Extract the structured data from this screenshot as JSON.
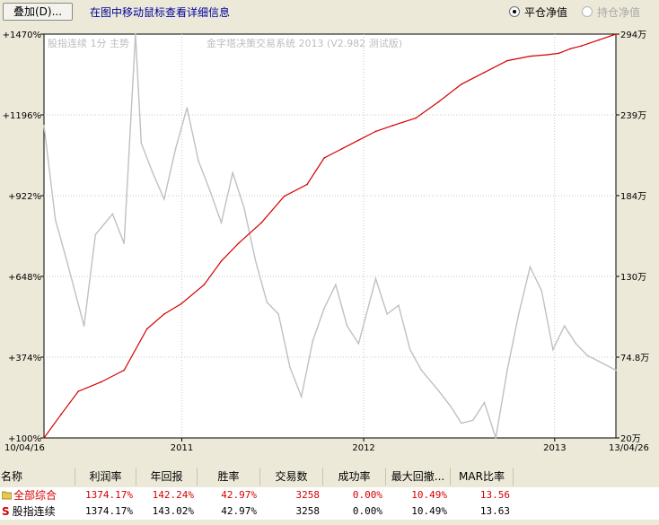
{
  "toolbar": {
    "overlay_label": "叠加(D)...",
    "hint": "在图中移动鼠标查看详细信息",
    "radio_flat": "平仓净值",
    "radio_hold": "持仓净值"
  },
  "chart_data": {
    "type": "line",
    "watermark_left": "股指连续 1分 主势",
    "watermark_title": "金字塔决策交易系统 2013 (V2.982 测试版)",
    "x_start_label": "10/04/16",
    "x_end_label": "13/04/26",
    "x_year_ticks": [
      "2011",
      "2012",
      "2013"
    ],
    "left_axis_ticks": [
      "+1470%",
      "+1196%",
      "+922%",
      "+648%",
      "+374%",
      "+100%"
    ],
    "right_axis_ticks": [
      "294万",
      "239万",
      "184万",
      "130万",
      "74.8万",
      "20万"
    ],
    "ylim_left": [
      100,
      1470
    ],
    "series": [
      {
        "name": "平仓净值",
        "color": "#d40000",
        "x": [
          0.0,
          0.03,
          0.06,
          0.1,
          0.14,
          0.18,
          0.21,
          0.24,
          0.28,
          0.31,
          0.34,
          0.38,
          0.42,
          0.46,
          0.49,
          0.52,
          0.55,
          0.58,
          0.61,
          0.65,
          0.69,
          0.73,
          0.77,
          0.81,
          0.85,
          0.88,
          0.9,
          0.92,
          0.94,
          0.97,
          1.0
        ],
        "values": [
          100,
          180,
          258,
          290,
          330,
          470,
          520,
          555,
          620,
          700,
          760,
          830,
          920,
          960,
          1050,
          1080,
          1110,
          1140,
          1160,
          1185,
          1240,
          1300,
          1340,
          1380,
          1395,
          1400,
          1405,
          1420,
          1430,
          1450,
          1470
        ]
      },
      {
        "name": "股指连续",
        "color": "#c0c0c0",
        "x": [
          0.0,
          0.02,
          0.04,
          0.07,
          0.09,
          0.12,
          0.14,
          0.16,
          0.17,
          0.19,
          0.21,
          0.23,
          0.25,
          0.27,
          0.29,
          0.31,
          0.33,
          0.35,
          0.37,
          0.39,
          0.41,
          0.43,
          0.45,
          0.47,
          0.49,
          0.51,
          0.53,
          0.55,
          0.58,
          0.6,
          0.62,
          0.64,
          0.66,
          0.69,
          0.71,
          0.73,
          0.75,
          0.77,
          0.79,
          0.81,
          0.83,
          0.85,
          0.87,
          0.89,
          0.91,
          0.93,
          0.95,
          0.97,
          1.0
        ],
        "values": [
          1160,
          840,
          700,
          480,
          790,
          860,
          760,
          1470,
          1100,
          1000,
          910,
          1080,
          1220,
          1040,
          940,
          830,
          1000,
          880,
          700,
          560,
          520,
          340,
          240,
          430,
          540,
          620,
          480,
          420,
          640,
          520,
          550,
          400,
          330,
          260,
          210,
          150,
          160,
          220,
          100,
          330,
          520,
          680,
          600,
          400,
          480,
          420,
          380,
          360,
          330
        ]
      }
    ]
  },
  "table": {
    "headers": [
      "名称",
      "利润率",
      "年回报",
      "胜率",
      "交易数",
      "成功率",
      "最大回撤...",
      "MAR比率"
    ],
    "rows": [
      {
        "name": "全部综合",
        "cells": [
          "1374.17%",
          "142.24%",
          "42.97%",
          "3258",
          "0.00%",
          "10.49%",
          "13.56"
        ]
      },
      {
        "name": "股指连续",
        "cells": [
          "1374.17%",
          "143.02%",
          "42.97%",
          "3258",
          "0.00%",
          "10.49%",
          "13.63"
        ]
      }
    ],
    "row2_marker": "S"
  }
}
